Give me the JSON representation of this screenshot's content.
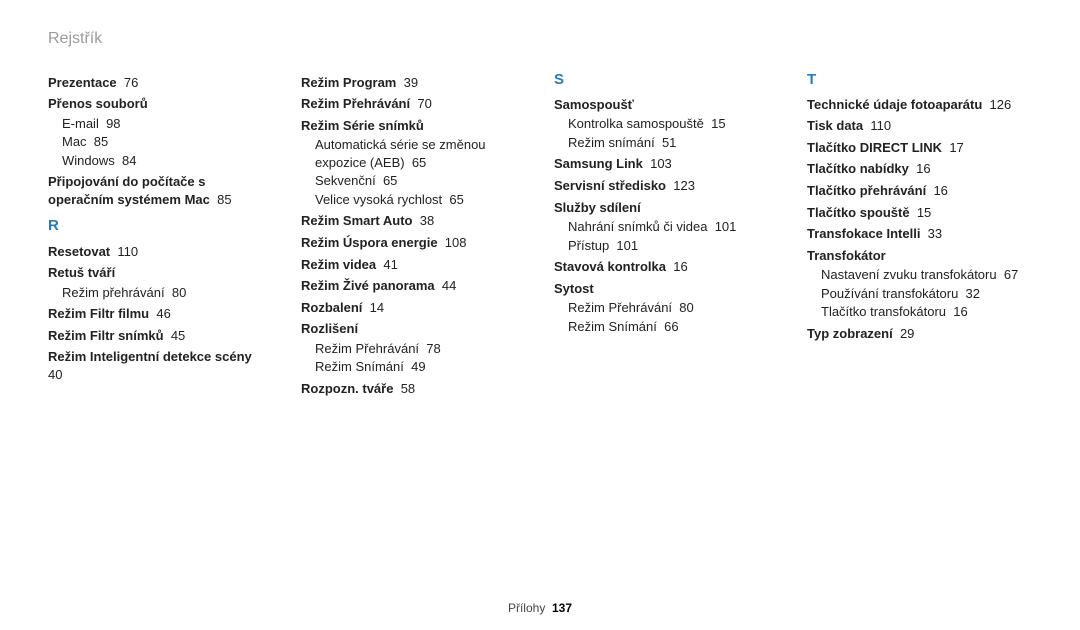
{
  "running_head": "Rejstřík",
  "footer": {
    "label": "Přílohy",
    "page": "137"
  },
  "letters": {
    "R": "R",
    "S": "S",
    "T": "T"
  },
  "col1": {
    "prezentace": {
      "t": "Prezentace",
      "p": "76"
    },
    "prenos": {
      "t": "Přenos souborů"
    },
    "prenos_sub": [
      {
        "t": "E-mail",
        "p": "98"
      },
      {
        "t": "Mac",
        "p": "85"
      },
      {
        "t": "Windows",
        "p": "84"
      }
    ],
    "pripojeni": {
      "t": "Připojování do počítače s operačním systémem Mac",
      "p": "85"
    },
    "resetovat": {
      "t": "Resetovat",
      "p": "110"
    },
    "retus": {
      "t": "Retuš tváří"
    },
    "retus_sub": [
      {
        "t": "Režim přehrávání",
        "p": "80"
      }
    ],
    "rff": {
      "t": "Režim Filtr filmu",
      "p": "46"
    },
    "rfs": {
      "t": "Režim Filtr snímků",
      "p": "45"
    },
    "rids": {
      "t": "Režim Inteligentní detekce scény",
      "p": "40"
    }
  },
  "col2": {
    "rprog": {
      "t": "Režim Program",
      "p": "39"
    },
    "rpreh": {
      "t": "Režim Přehrávání",
      "p": "70"
    },
    "rserie": {
      "t": "Režim Série snímků"
    },
    "rserie_sub": [
      {
        "t": "Automatická série se změnou expozice (AEB)",
        "p": "65"
      },
      {
        "t": "Sekvenční",
        "p": "65"
      },
      {
        "t": "Velice vysoká rychlost",
        "p": "65"
      }
    ],
    "rsmart": {
      "t": "Režim Smart Auto",
      "p": "38"
    },
    "ruspor": {
      "t": "Režim Úspora energie",
      "p": "108"
    },
    "rvidea": {
      "t": "Režim videa",
      "p": "41"
    },
    "rzive": {
      "t": "Režim Živé panorama",
      "p": "44"
    },
    "rozbal": {
      "t": "Rozbalení",
      "p": "14"
    },
    "rozlis": {
      "t": "Rozlišení"
    },
    "rozlis_sub": [
      {
        "t": "Režim Přehrávání",
        "p": "78"
      },
      {
        "t": "Režim Snímání",
        "p": "49"
      }
    ],
    "rozpozn": {
      "t": "Rozpozn. tváře",
      "p": "58"
    }
  },
  "col3": {
    "samo": {
      "t": "Samospoušť"
    },
    "samo_sub": [
      {
        "t": "Kontrolka samospouště",
        "p": "15"
      },
      {
        "t": "Režim snímání",
        "p": "51"
      }
    ],
    "slink": {
      "t": "Samsung Link",
      "p": "103"
    },
    "serv": {
      "t": "Servisní středisko",
      "p": "123"
    },
    "sluzby": {
      "t": "Služby sdílení"
    },
    "sluzby_sub": [
      {
        "t": "Nahrání snímků či videa",
        "p": "101"
      },
      {
        "t": "Přístup",
        "p": "101"
      }
    ],
    "stav": {
      "t": "Stavová kontrolka",
      "p": "16"
    },
    "sytost": {
      "t": "Sytost"
    },
    "sytost_sub": [
      {
        "t": "Režim Přehrávání",
        "p": "80"
      },
      {
        "t": "Režim Snímání",
        "p": "66"
      }
    ]
  },
  "col4": {
    "tech": {
      "t": "Technické údaje fotoaparátu",
      "p": "126"
    },
    "tisk": {
      "t": "Tisk data",
      "p": "110"
    },
    "tdl": {
      "t": "Tlačítko DIRECT LINK",
      "p": "17"
    },
    "tnab": {
      "t": "Tlačítko nabídky",
      "p": "16"
    },
    "tpreh": {
      "t": "Tlačítko přehrávání",
      "p": "16"
    },
    "tspou": {
      "t": "Tlačítko spouště",
      "p": "15"
    },
    "tint": {
      "t": "Transfokace Intelli",
      "p": "33"
    },
    "transf": {
      "t": "Transfokátor"
    },
    "transf_sub": [
      {
        "t": "Nastavení zvuku transfokátoru",
        "p": "67"
      },
      {
        "t": "Používání transfokátoru",
        "p": "32"
      },
      {
        "t": "Tlačítko transfokátoru",
        "p": "16"
      }
    ],
    "typ": {
      "t": "Typ zobrazení",
      "p": "29"
    }
  }
}
